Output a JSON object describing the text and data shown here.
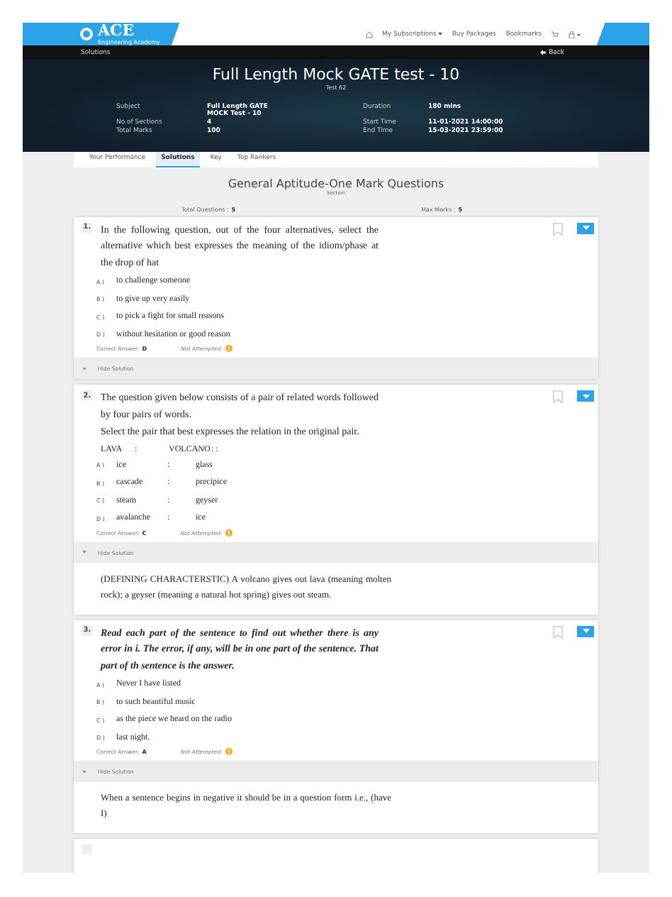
{
  "header": {
    "logo": "ACE",
    "logo_tagline": "Engineering Academy",
    "nav": [
      {
        "label": "My Subscriptions",
        "dropdown": true
      },
      {
        "label": "Buy Packages",
        "dropdown": false
      },
      {
        "label": "Bookmarks",
        "dropdown": false
      }
    ]
  },
  "breadcrumb": {
    "label": "Solutions",
    "back": "Back"
  },
  "hero": {
    "title": "Full Length Mock GATE test - 10",
    "subtitle": "Test 62",
    "left": [
      {
        "label": "Subject",
        "value": "Full Length GATE MOCK Test - 10"
      },
      {
        "label": "No.of Sections",
        "value": "4"
      },
      {
        "label": "Total Marks",
        "value": "100"
      }
    ],
    "right": [
      {
        "label": "Duration",
        "value": "180 mins"
      },
      {
        "label": "Start Time",
        "value": "11-01-2021 14:00:00"
      },
      {
        "label": "End Time",
        "value": "15-03-2021 23:59:00"
      }
    ]
  },
  "tabs": [
    {
      "label": "Your Performance",
      "selected": false
    },
    {
      "label": "Solutions",
      "selected": true
    },
    {
      "label": "Key",
      "selected": false
    },
    {
      "label": "Top Rankers",
      "selected": false
    }
  ],
  "section": {
    "title": "General Aptitude-One Mark Questions",
    "subtitle": "Section",
    "total_label": "Total Questions :",
    "total": "5",
    "max_label": "Max Marks :",
    "max": "5"
  },
  "questions": [
    {
      "number": "1.",
      "kind": "plain",
      "prompt": [
        "In the following question, out of the four alternatives, select the alternative which best expresses the meaning of the idiom/phase at the drop of hat"
      ],
      "options": [
        {
          "kind": "text",
          "label": "A )",
          "text": "to challenge someone"
        },
        {
          "kind": "text",
          "label": "B )",
          "text": "to give up very easily"
        },
        {
          "kind": "text",
          "label": "C )",
          "text": "to pick a fight for small reasons"
        },
        {
          "kind": "text",
          "label": "D )",
          "text": "without hesitation or good reason"
        }
      ],
      "answer_label": "Correct Answer:",
      "answer": "D",
      "status": "Not Attempted:",
      "toggle": "Hide Solution"
    },
    {
      "number": "2.",
      "kind": "plain",
      "prompt": [
        "The question given below consists of a pair of related words followed by four pairs of words.",
        "Select the pair that best expresses the relation in the original pair."
      ],
      "pair": {
        "left": "LAVA",
        "sep": ":",
        "right": "VOLCANO",
        "tail": ": :"
      },
      "options": [
        {
          "kind": "pair",
          "label": "A )",
          "text": "ice",
          "sep": ":",
          "right": "glass"
        },
        {
          "kind": "pair",
          "label": "B )",
          "text": "cascade",
          "sep": ":",
          "right": "precipice"
        },
        {
          "kind": "pair",
          "label": "C )",
          "text": "steam",
          "sep": ":",
          "right": "geyser"
        },
        {
          "kind": "pair",
          "label": "D )",
          "text": "avalanche",
          "sep": ":",
          "right": "ice"
        }
      ],
      "answer_label": "Correct Answer:",
      "answer": "C",
      "status": "Not Attempted:",
      "toggle": "Hide Solution",
      "solution": "(DEFINING CHARACTERSTIC) A volcano gives out lava (meaning molten rock); a geyser (meaning a natural hot spring) gives out steam."
    },
    {
      "number": "3.",
      "kind": "emphasis",
      "prompt": [
        "Read each part of the sentence to find out whether there is any error in i. The error, if any, will be in one part of the sentence. That part of th sentence is the answer."
      ],
      "options": [
        {
          "kind": "text",
          "label": "A )",
          "text": "Never I have listed"
        },
        {
          "kind": "text",
          "label": "B )",
          "text": "to such beautiful music"
        },
        {
          "kind": "text",
          "label": "C )",
          "text": "as the piece we heard on the radio"
        },
        {
          "kind": "text",
          "label": "D )",
          "text": "last night."
        }
      ],
      "answer_label": "Correct Answer:",
      "answer": "A",
      "status": "Not Attempted:",
      "toggle": "Hide Solution",
      "solution": "When a sentence begins in negative it should be in a question form i.e., (have I)"
    }
  ]
}
